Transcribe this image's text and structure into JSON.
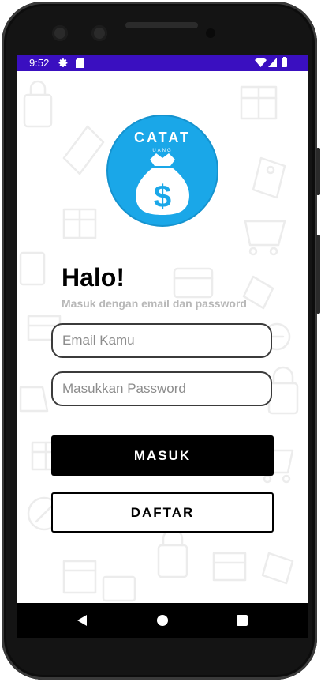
{
  "status_bar": {
    "time": "9:52",
    "icons": [
      "settings-icon",
      "sd-card-icon",
      "wifi-icon",
      "cellular-icon",
      "battery-icon"
    ]
  },
  "logo": {
    "text_top": "CATAT",
    "text_small": "UANG",
    "symbol": "$",
    "color": "#1aa7e8"
  },
  "login": {
    "title": "Halo!",
    "subtitle": "Masuk dengan email dan password",
    "email_placeholder": "Email Kamu",
    "email_value": "",
    "password_placeholder": "Masukkan Password",
    "password_value": "",
    "login_button": "MASUK",
    "register_button": "DAFTAR"
  },
  "nav_bar": {
    "buttons": [
      "back-icon",
      "home-icon",
      "recents-icon"
    ]
  },
  "colors": {
    "status_bar": "#3a0fc0",
    "logo_blue": "#1aa7e8",
    "primary_button": "#000000",
    "subtitle_text": "#b8b8b8"
  }
}
